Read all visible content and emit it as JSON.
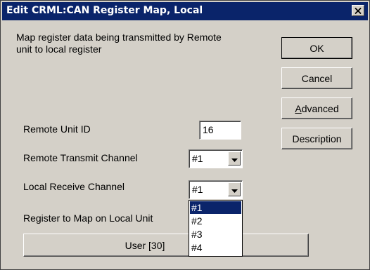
{
  "window": {
    "title": "Edit CRML:CAN Register Map, Local"
  },
  "description": {
    "line1": "Map register data being transmitted by Remote",
    "line2": "unit to local register"
  },
  "buttons": {
    "ok": "OK",
    "cancel": "Cancel",
    "advanced_accel": "A",
    "advanced_rest": "dvanced",
    "description": "Description"
  },
  "fields": {
    "remote_unit_id_label": "Remote Unit ID",
    "remote_unit_id_value": "16",
    "remote_transmit_label": "Remote Transmit Channel",
    "remote_transmit_value": "#1",
    "local_receive_label": "Local Receive Channel",
    "local_receive_value": "#1",
    "register_label": "Register to Map on Local Unit",
    "register_button": "User [30]"
  },
  "dropdown": {
    "options": [
      "#1",
      "#2",
      "#3",
      "#4"
    ],
    "selected": "#1"
  },
  "icons": {
    "close": "close-icon",
    "dropdown_arrow": "chevron-down-icon"
  }
}
